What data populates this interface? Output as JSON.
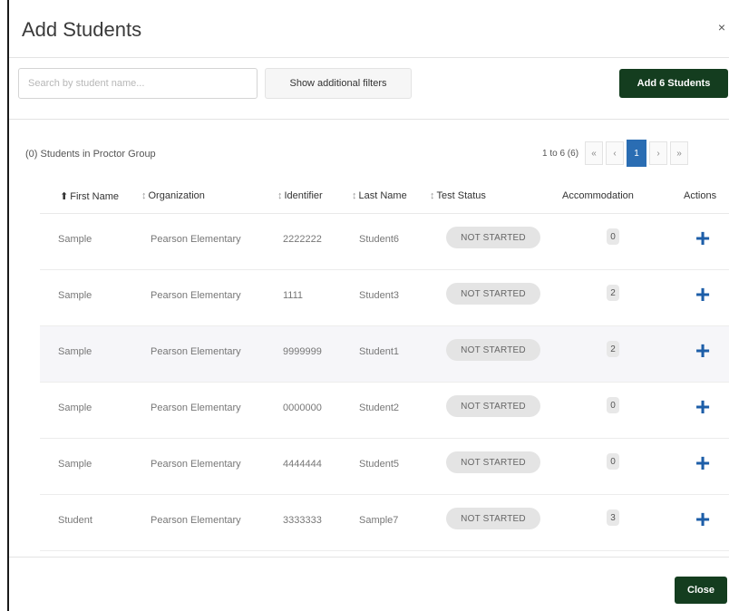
{
  "modal": {
    "title": "Add Students",
    "close_icon": "×"
  },
  "toolbar": {
    "search_placeholder": "Search by student name...",
    "filters_label": "Show additional filters",
    "add_label": "Add 6 Students"
  },
  "summary": {
    "count_label": "(0) Students in Proctor Group"
  },
  "pager": {
    "range": "1 to 6 (6)",
    "first": "«",
    "prev": "‹",
    "current": "1",
    "next": "›",
    "last": "»"
  },
  "table": {
    "columns": {
      "first_name": "First Name",
      "organization": "Organization",
      "identifier": "Identifier",
      "last_name": "Last Name",
      "test_status": "Test Status",
      "accommodation": "Accommodation",
      "actions": "Actions"
    },
    "sort_icons": {
      "active": "⬆",
      "inactive": "↕"
    },
    "action_icon": "+",
    "rows": [
      {
        "first_name": "Sample",
        "organization": "Pearson Elementary",
        "identifier": "2222222",
        "last_name": "Student6",
        "status": "NOT STARTED",
        "accommodation": "0"
      },
      {
        "first_name": "Sample",
        "organization": "Pearson Elementary",
        "identifier": "1111",
        "last_name": "Student3",
        "status": "NOT STARTED",
        "accommodation": "2"
      },
      {
        "first_name": "Sample",
        "organization": "Pearson Elementary",
        "identifier": "9999999",
        "last_name": "Student1",
        "status": "NOT STARTED",
        "accommodation": "2"
      },
      {
        "first_name": "Sample",
        "organization": "Pearson Elementary",
        "identifier": "0000000",
        "last_name": "Student2",
        "status": "NOT STARTED",
        "accommodation": "0"
      },
      {
        "first_name": "Sample",
        "organization": "Pearson Elementary",
        "identifier": "4444444",
        "last_name": "Student5",
        "status": "NOT STARTED",
        "accommodation": "0"
      },
      {
        "first_name": "Student",
        "organization": "Pearson Elementary",
        "identifier": "3333333",
        "last_name": "Sample7",
        "status": "NOT STARTED",
        "accommodation": "3"
      }
    ]
  },
  "footer": {
    "close_label": "Close"
  },
  "colors": {
    "primary_dark_green": "#143d1f",
    "action_blue": "#1d5ea8",
    "pager_active": "#2a6db3"
  }
}
